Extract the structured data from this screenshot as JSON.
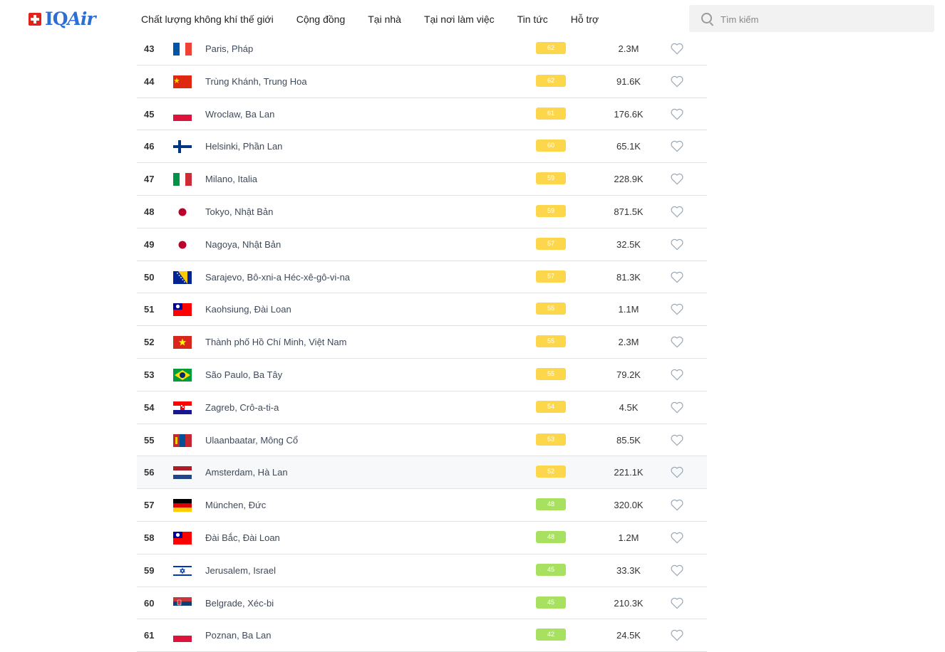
{
  "header": {
    "brand": "IQAir",
    "nav": [
      "Chất lượng không khí thế giới",
      "Cộng đồng",
      "Tại nhà",
      "Tại nơi làm việc",
      "Tin tức",
      "Hỗ trợ"
    ],
    "search_placeholder": "Tìm kiếm"
  },
  "colors": {
    "aqi_yellow": "#fdd74b",
    "aqi_green": "#a8e05f",
    "brand": "#2b6fd6",
    "swiss_red": "#e2231a"
  },
  "rows": [
    {
      "rank": "43",
      "city": "Paris, Pháp",
      "aqi": "62",
      "level": "moderate",
      "population": "2.3M",
      "flag": "france"
    },
    {
      "rank": "44",
      "city": "Trùng Khánh, Trung Hoa",
      "aqi": "62",
      "level": "moderate",
      "population": "91.6K",
      "flag": "china"
    },
    {
      "rank": "45",
      "city": "Wroclaw, Ba Lan",
      "aqi": "61",
      "level": "moderate",
      "population": "176.6K",
      "flag": "poland"
    },
    {
      "rank": "46",
      "city": "Helsinki, Phần Lan",
      "aqi": "60",
      "level": "moderate",
      "population": "65.1K",
      "flag": "finland"
    },
    {
      "rank": "47",
      "city": "Milano, Italia",
      "aqi": "59",
      "level": "moderate",
      "population": "228.9K",
      "flag": "italy"
    },
    {
      "rank": "48",
      "city": "Tokyo, Nhật Bản",
      "aqi": "59",
      "level": "moderate",
      "population": "871.5K",
      "flag": "japan"
    },
    {
      "rank": "49",
      "city": "Nagoya, Nhật Bản",
      "aqi": "57",
      "level": "moderate",
      "population": "32.5K",
      "flag": "japan"
    },
    {
      "rank": "50",
      "city": "Sarajevo, Bô-xni-a Héc-xê-gô-vi-na",
      "aqi": "57",
      "level": "moderate",
      "population": "81.3K",
      "flag": "bosnia"
    },
    {
      "rank": "51",
      "city": "Kaohsiung, Đài Loan",
      "aqi": "55",
      "level": "moderate",
      "population": "1.1M",
      "flag": "taiwan"
    },
    {
      "rank": "52",
      "city": "Thành phố Hồ Chí Minh, Việt Nam",
      "aqi": "55",
      "level": "moderate",
      "population": "2.3M",
      "flag": "vietnam"
    },
    {
      "rank": "53",
      "city": "São Paulo, Ba Tây",
      "aqi": "55",
      "level": "moderate",
      "population": "79.2K",
      "flag": "brazil"
    },
    {
      "rank": "54",
      "city": "Zagreb, Crô-a-ti-a",
      "aqi": "54",
      "level": "moderate",
      "population": "4.5K",
      "flag": "croatia"
    },
    {
      "rank": "55",
      "city": "Ulaanbaatar, Mông Cổ",
      "aqi": "53",
      "level": "moderate",
      "population": "85.5K",
      "flag": "mongolia"
    },
    {
      "rank": "56",
      "city": "Amsterdam, Hà Lan",
      "aqi": "52",
      "level": "moderate",
      "population": "221.1K",
      "flag": "netherlands",
      "highlight": true
    },
    {
      "rank": "57",
      "city": "München, Đức",
      "aqi": "48",
      "level": "good",
      "population": "320.0K",
      "flag": "germany"
    },
    {
      "rank": "58",
      "city": "Đài Bắc, Đài Loan",
      "aqi": "48",
      "level": "good",
      "population": "1.2M",
      "flag": "taiwan"
    },
    {
      "rank": "59",
      "city": "Jerusalem, Israel",
      "aqi": "45",
      "level": "good",
      "population": "33.3K",
      "flag": "israel"
    },
    {
      "rank": "60",
      "city": "Belgrade, Xéc-bi",
      "aqi": "45",
      "level": "good",
      "population": "210.3K",
      "flag": "serbia"
    },
    {
      "rank": "61",
      "city": "Poznan, Ba Lan",
      "aqi": "42",
      "level": "good",
      "population": "24.5K",
      "flag": "poland"
    }
  ]
}
